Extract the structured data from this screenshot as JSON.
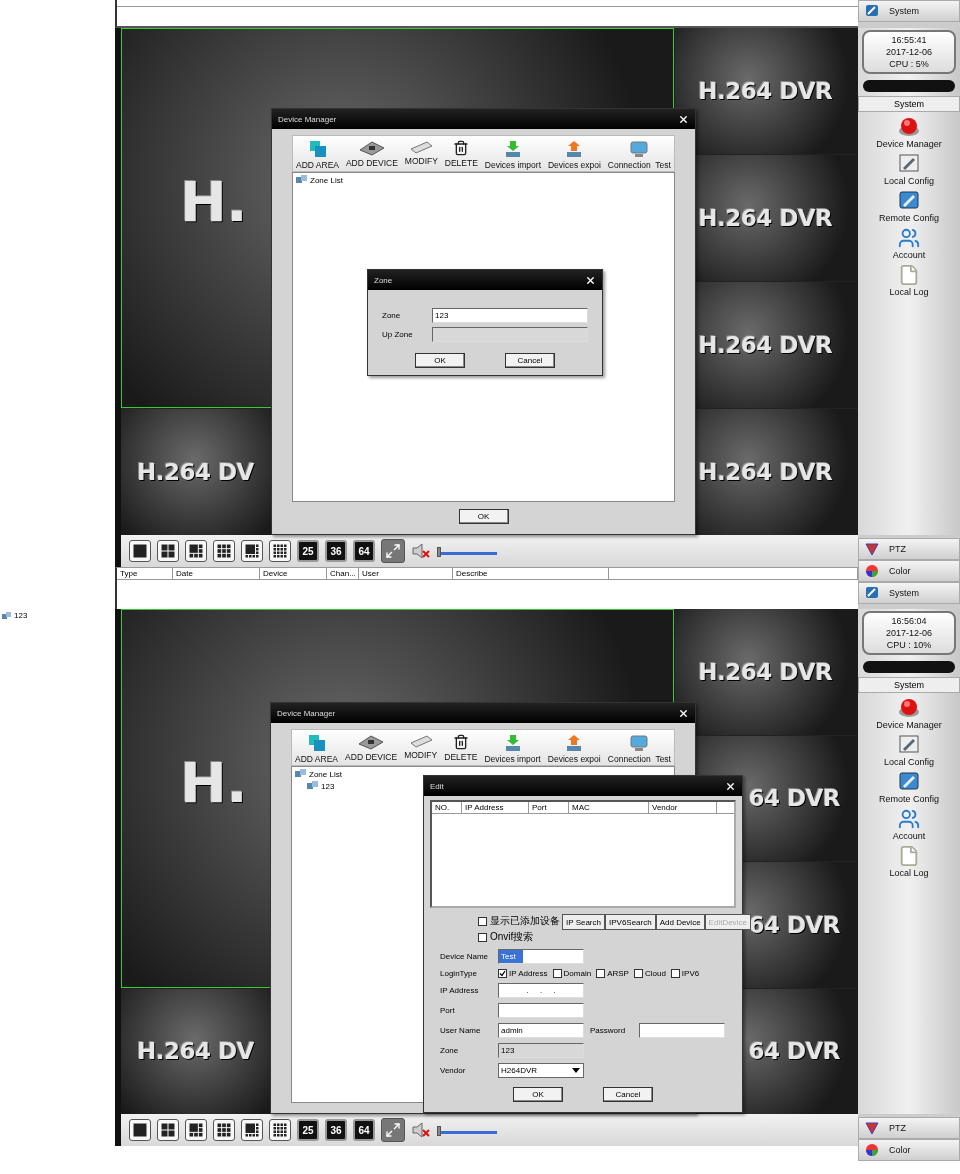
{
  "top_strip": {
    "system_button": "System"
  },
  "panels": [
    {
      "clock": {
        "time": "16:55:41",
        "date": "2017-12-06",
        "cpu": "CPU : 5%"
      },
      "tiles": [
        {
          "label": "H.264 DVR"
        },
        {
          "label": "H."
        },
        {
          "label": "H.264 DVR"
        },
        {
          "label": "H.264 DVR"
        },
        {
          "label": "H.264 DV"
        },
        {
          "label": "H.264 DVR"
        }
      ],
      "sidebar": {
        "header": "System",
        "items": [
          {
            "label": "Device Manager",
            "kind": "device"
          },
          {
            "label": "Local Config",
            "kind": "local"
          },
          {
            "label": "Remote Config",
            "kind": "remote"
          },
          {
            "label": "Account",
            "kind": "account"
          },
          {
            "label": "Local Log",
            "kind": "log"
          }
        ]
      },
      "toolbar": {
        "layouts": [
          {
            "kind": "grid1"
          },
          {
            "kind": "grid4"
          },
          {
            "kind": "grid6"
          },
          {
            "kind": "grid9"
          },
          {
            "kind": "grid8"
          },
          {
            "kind": "grid16"
          },
          {
            "kind": "text",
            "label": "25"
          },
          {
            "kind": "text",
            "label": "36"
          },
          {
            "kind": "text",
            "label": "64"
          },
          {
            "kind": "fullscreen"
          }
        ],
        "volume": {
          "level": 0
        }
      },
      "side_buttons": [
        {
          "label": "PTZ",
          "kind": "ptz"
        },
        {
          "label": "Color",
          "kind": "color"
        },
        {
          "label": "System",
          "kind": "system"
        }
      ],
      "log_columns": [
        "Type",
        "Date",
        "Device",
        "Chan...",
        "User",
        "Describe"
      ],
      "device_manager": {
        "title": "Device Manager",
        "tools": [
          {
            "label": "ADD AREA",
            "kind": "area"
          },
          {
            "label": "ADD DEVICE",
            "kind": "device"
          },
          {
            "label": "MODIFY",
            "kind": "modify"
          },
          {
            "label": "DELETE",
            "kind": "delete"
          },
          {
            "label": "Devices import",
            "kind": "import"
          },
          {
            "label": "Devices expoi",
            "kind": "export"
          },
          {
            "label": "Connection  Test",
            "kind": "test"
          }
        ],
        "tree": [
          {
            "label": "Zone List"
          }
        ],
        "ok_button": "OK",
        "zone_dialog": {
          "title": "Zone",
          "fields": [
            {
              "label": "Zone",
              "value": "123",
              "disabled": false
            },
            {
              "label": "Up Zone",
              "disabled": true
            }
          ],
          "buttons": [
            "OK",
            "Cancel"
          ]
        }
      }
    },
    {
      "side_tree": {
        "label": "123"
      },
      "clock": {
        "time": "16:56:04",
        "date": "2017-12-06",
        "cpu": "CPU : 10%"
      },
      "tiles": [
        {
          "label": "H.264 DVR"
        },
        {
          "label": "H."
        },
        {
          "label": "64 DVR"
        },
        {
          "label": "64 DVR"
        },
        {
          "label": "H.264 DV"
        },
        {
          "label": "64 DVR"
        }
      ],
      "sidebar": {
        "header": "System",
        "items": [
          {
            "label": "Device Manager",
            "kind": "device"
          },
          {
            "label": "Local Config",
            "kind": "local"
          },
          {
            "label": "Remote Config",
            "kind": "remote"
          },
          {
            "label": "Account",
            "kind": "account"
          },
          {
            "label": "Local Log",
            "kind": "log"
          }
        ]
      },
      "toolbar": {
        "layouts": [
          {
            "kind": "grid1"
          },
          {
            "kind": "grid4"
          },
          {
            "kind": "grid6"
          },
          {
            "kind": "grid9"
          },
          {
            "kind": "grid8"
          },
          {
            "kind": "grid16"
          },
          {
            "kind": "text",
            "label": "25"
          },
          {
            "kind": "text",
            "label": "36"
          },
          {
            "kind": "text",
            "label": "64"
          },
          {
            "kind": "fullscreen"
          }
        ],
        "volume": {
          "level": 0
        }
      },
      "side_buttons": [
        {
          "label": "PTZ",
          "kind": "ptz"
        },
        {
          "label": "Color",
          "kind": "color"
        }
      ],
      "device_manager": {
        "title": "Device Manager",
        "tools": [
          {
            "label": "ADD AREA",
            "kind": "area"
          },
          {
            "label": "ADD DEVICE",
            "kind": "device"
          },
          {
            "label": "MODIFY",
            "kind": "modify"
          },
          {
            "label": "DELETE",
            "kind": "delete"
          },
          {
            "label": "Devices import",
            "kind": "import"
          },
          {
            "label": "Devices expoi",
            "kind": "export"
          },
          {
            "label": "Connection  Test",
            "kind": "test"
          }
        ],
        "tree": [
          {
            "label": "Zone List",
            "children": [
              {
                "label": "123"
              }
            ]
          }
        ],
        "edit_dialog": {
          "title": "Edit",
          "columns": [
            "NO.",
            "IP Address",
            "Port",
            "MAC",
            "Vendor"
          ],
          "options": [
            {
              "label": "显示已添加设备",
              "checked": false
            },
            {
              "label": "Onvif搜索",
              "checked": false
            }
          ],
          "actions": [
            {
              "label": "IP Search",
              "disabled": false
            },
            {
              "label": "IPV6Search",
              "disabled": false
            },
            {
              "label": "Add Device",
              "disabled": false
            },
            {
              "label": "EditDevice",
              "disabled": true
            }
          ],
          "device_name": {
            "label": "Device Name",
            "value": "Test",
            "highlighted": true
          },
          "login_type": {
            "label": "LoginType",
            "options": [
              {
                "label": "IP Address",
                "checked": true
              },
              {
                "label": "Domain",
                "checked": false
              },
              {
                "label": "ARSP",
                "checked": false
              },
              {
                "label": "Cloud",
                "checked": false
              },
              {
                "label": "IPV6",
                "checked": false
              }
            ]
          },
          "ip_address": {
            "label": "IP Address",
            "value": ".     .     ."
          },
          "port": {
            "label": "Port"
          },
          "user_name": {
            "label": "User Name",
            "value": "admin"
          },
          "password": {
            "label": "Password"
          },
          "zone": {
            "label": "Zone",
            "value": "123",
            "disabled": true
          },
          "vendor": {
            "label": "Vendor",
            "value": "H264DVR"
          },
          "buttons": [
            "OK",
            "Cancel"
          ]
        }
      }
    }
  ]
}
